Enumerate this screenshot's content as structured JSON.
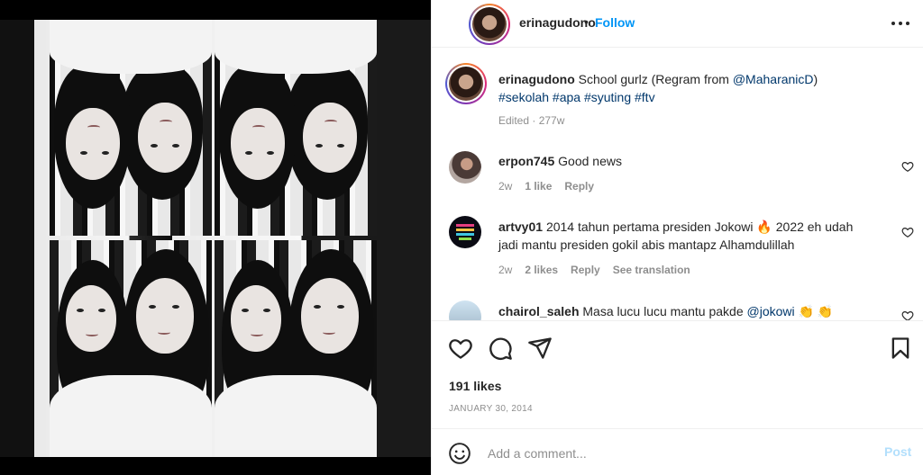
{
  "post": {
    "author": "erinagudono",
    "separator": "•",
    "follow_label": "Follow",
    "caption_text": "School gurlz (Regram from ",
    "caption_mention": "@MaharanicD",
    "caption_close": ")",
    "hashtags": "#sekolah #apa #syuting #ftv",
    "caption_meta": "Edited · 277w",
    "likes": "191 likes",
    "date": "JANUARY 30, 2014"
  },
  "comments": [
    {
      "user": "erpon745",
      "text": "Good news",
      "age": "2w",
      "likes": "1 like",
      "reply": "Reply"
    },
    {
      "user": "artvy01",
      "text_line1": "2014 tahun pertama presiden Jokowi 🔥 2022 eh udah",
      "text_line2": "jadi mantu presiden gokil abis mantapz Alhamdulillah",
      "age": "2w",
      "likes": "2 likes",
      "reply": "Reply",
      "translate": "See translation"
    },
    {
      "user": "chairol_saleh",
      "text": "Masa lucu lucu mantu pakde ",
      "mention": "@jokowi",
      "emoji": " 👏 👏"
    }
  ],
  "composer": {
    "placeholder": "Add a comment...",
    "post_label": "Post"
  },
  "icons": {
    "more": "more-horizontal-icon",
    "like": "heart-icon",
    "comment": "comment-icon",
    "share": "share-icon",
    "save": "bookmark-icon",
    "emoji": "emoji-icon"
  },
  "colors": {
    "accent": "#0095f6",
    "hashtag": "#00376b",
    "muted": "#8e8e8e",
    "post_disabled": "#b2dffc"
  }
}
